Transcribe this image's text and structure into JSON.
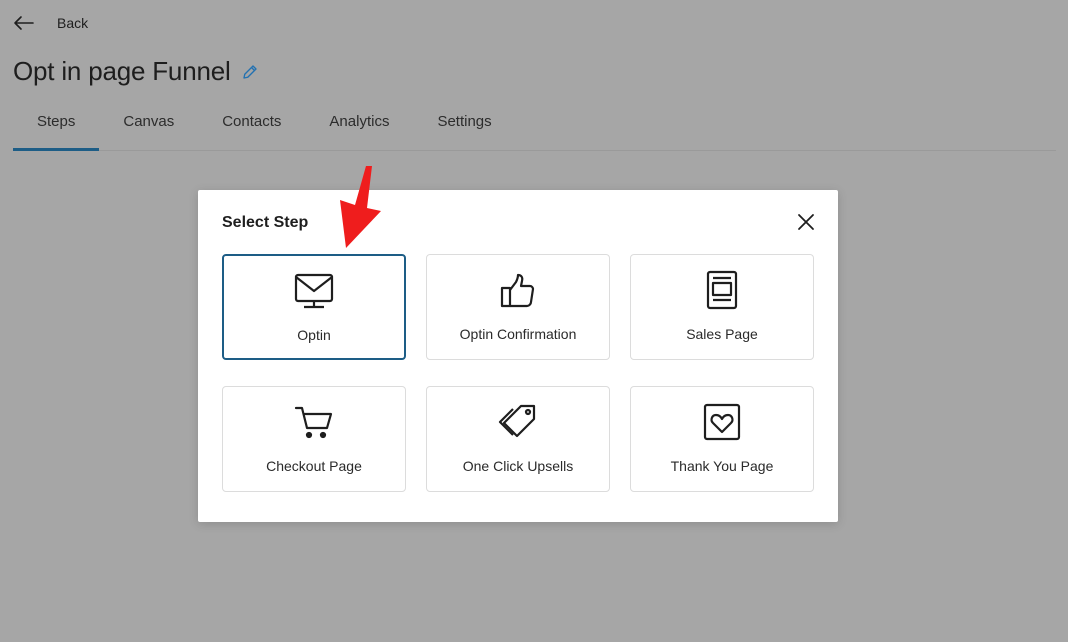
{
  "header": {
    "back_label": "Back",
    "title": "Opt in page Funnel"
  },
  "tabs": [
    {
      "label": "Steps",
      "active": true
    },
    {
      "label": "Canvas",
      "active": false
    },
    {
      "label": "Contacts",
      "active": false
    },
    {
      "label": "Analytics",
      "active": false
    },
    {
      "label": "Settings",
      "active": false
    }
  ],
  "modal": {
    "title": "Select Step",
    "steps": [
      {
        "label": "Optin",
        "icon": "envelope-icon",
        "selected": true
      },
      {
        "label": "Optin Confirmation",
        "icon": "thumbs-up-icon",
        "selected": false
      },
      {
        "label": "Sales Page",
        "icon": "page-layout-icon",
        "selected": false
      },
      {
        "label": "Checkout Page",
        "icon": "cart-icon",
        "selected": false
      },
      {
        "label": "One Click Upsells",
        "icon": "tags-icon",
        "selected": false
      },
      {
        "label": "Thank You Page",
        "icon": "heart-frame-icon",
        "selected": false
      }
    ]
  },
  "colors": {
    "backdrop": "#a6a6a6",
    "accent": "#1d5d86",
    "annotation_arrow": "#ef1d1d"
  }
}
